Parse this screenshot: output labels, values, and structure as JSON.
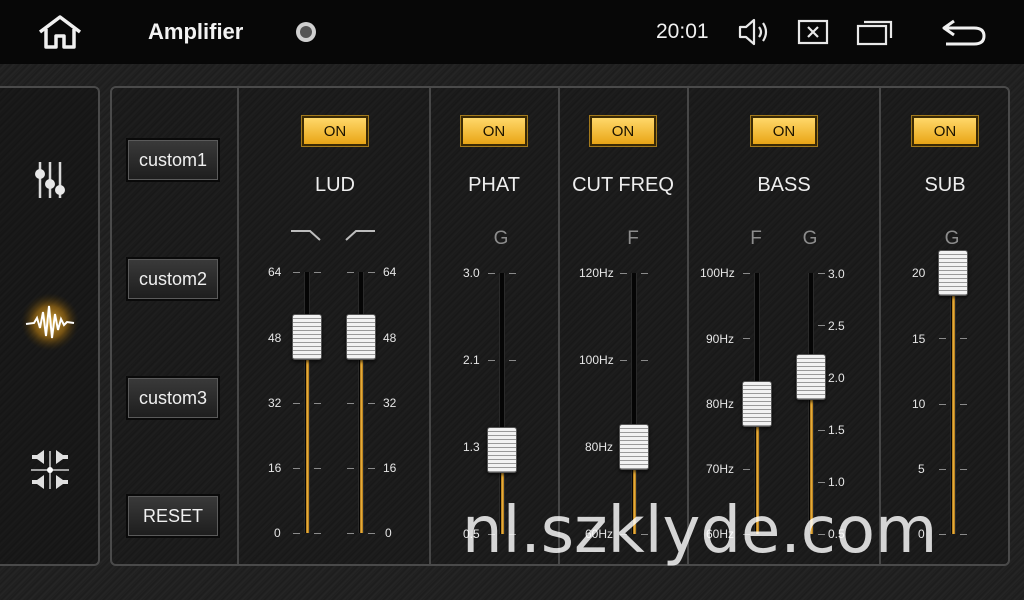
{
  "statusbar": {
    "title": "Amplifier",
    "time": "20:01"
  },
  "icons": {
    "home": "home-icon",
    "record": "record-dot-icon",
    "volume": "speaker-icon",
    "close": "close-box-icon",
    "recent": "recent-apps-icon",
    "back": "back-arrow-icon",
    "equalizer": "equalizer-sliders-icon",
    "amplifier": "waveform-icon",
    "balance": "speaker-balance-icon",
    "lud_low_curve": "low-shelf-curve-icon",
    "lud_high_curve": "high-shelf-curve-icon"
  },
  "accent_color": "#f0b43a",
  "presets": [
    "custom1",
    "custom2",
    "custom3",
    "RESET"
  ],
  "on_label": "ON",
  "sections": {
    "lud": {
      "label": "LUD",
      "on": true,
      "ticks": [
        "64",
        "48",
        "32",
        "16",
        "0"
      ],
      "sliders": [
        {
          "value": 48,
          "min": 0,
          "max": 64
        },
        {
          "value": 48,
          "min": 0,
          "max": 64
        }
      ]
    },
    "phat": {
      "label": "PHAT",
      "on": true,
      "sub": "G",
      "ticks": [
        "3.0",
        "2.1",
        "1.3",
        "0.5"
      ],
      "slider": {
        "value": 1.3,
        "min": 0.5,
        "max": 3.0
      }
    },
    "cut_freq": {
      "label": "CUT FREQ",
      "on": true,
      "sub": "F",
      "ticks": [
        "120Hz",
        "100Hz",
        "80Hz",
        "60Hz"
      ],
      "slider": {
        "value": 80,
        "min": 60,
        "max": 120
      }
    },
    "bass": {
      "label": "BASS",
      "on": true,
      "sub_f": "F",
      "sub_g": "G",
      "ticks_f": [
        "100Hz",
        "90Hz",
        "80Hz",
        "70Hz",
        "60Hz"
      ],
      "ticks_g": [
        "3.0",
        "2.5",
        "2.0",
        "1.5",
        "1.0",
        "0.5"
      ],
      "slider_f": {
        "value": 80,
        "min": 60,
        "max": 100
      },
      "slider_g": {
        "value": 2.0,
        "min": 0.5,
        "max": 3.0
      }
    },
    "sub": {
      "label": "SUB",
      "on": true,
      "sub": "G",
      "ticks": [
        "20",
        "15",
        "10",
        "5",
        "0"
      ],
      "slider": {
        "value": 20,
        "min": 0,
        "max": 20
      }
    }
  },
  "watermark": "nl.szklyde.com"
}
